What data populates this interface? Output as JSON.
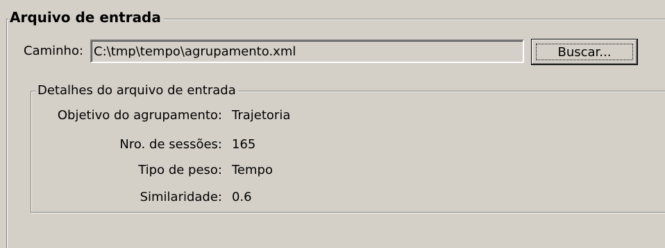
{
  "input_file_group": {
    "title": "Arquivo de entrada",
    "path_label": "Caminho:",
    "path_value": "C:\\tmp\\tempo\\agrupamento.xml",
    "browse_label": "Buscar..."
  },
  "details_group": {
    "title": "Detalhes do arquivo de entrada",
    "rows": [
      {
        "label": "Objetivo do agrupamento:",
        "value": "Trajetoria"
      },
      {
        "label": "Nro. de sessões:",
        "value": "165"
      },
      {
        "label": "Tipo de peso:",
        "value": "Tempo"
      },
      {
        "label": "Similaridade:",
        "value": "0.6"
      }
    ]
  },
  "colors": {
    "window_background": "#d4d0c8",
    "shadow": "#808080",
    "highlight": "#ffffff"
  }
}
